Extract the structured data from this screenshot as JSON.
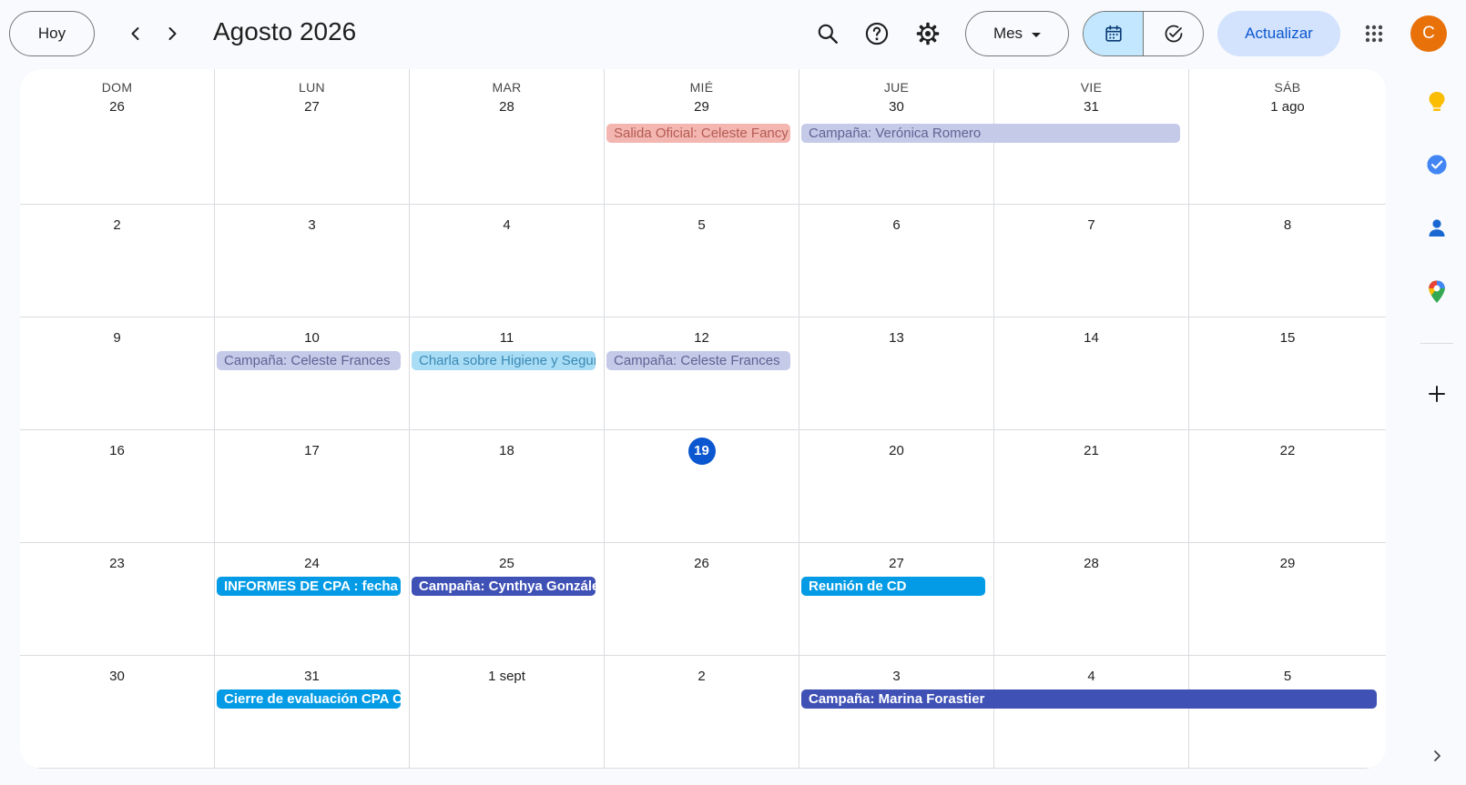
{
  "header": {
    "today_label": "Hoy",
    "title": "Agosto 2026",
    "view_label": "Mes",
    "update_label": "Actualizar",
    "avatar_letter": "C"
  },
  "colors": {
    "accent": "#0b57d0",
    "today_circle": "#0b57d0",
    "update_bg": "#d3e3fd",
    "avatar": "#e8710a",
    "toggle_active": "#c2e7ff"
  },
  "calendar": {
    "weekdays": [
      "DOM",
      "LUN",
      "MAR",
      "MIÉ",
      "JUE",
      "VIE",
      "SÁB"
    ],
    "weeks": [
      [
        "26",
        "27",
        "28",
        "29",
        "30",
        "31",
        "1 ago"
      ],
      [
        "2",
        "3",
        "4",
        "5",
        "6",
        "7",
        "8"
      ],
      [
        "9",
        "10",
        "11",
        "12",
        "13",
        "14",
        "15"
      ],
      [
        "16",
        "17",
        "18",
        "19",
        "20",
        "21",
        "22"
      ],
      [
        "23",
        "24",
        "25",
        "26",
        "27",
        "28",
        "29"
      ],
      [
        "30",
        "31",
        "1 sept",
        "2",
        "3",
        "4",
        "5"
      ]
    ],
    "today": {
      "week": 3,
      "day": 3
    },
    "events": [
      {
        "title": "Salida Oficial: Celeste Fancy",
        "week": 0,
        "start": 3,
        "span": 1,
        "bg": "#f4b6b1",
        "fg": "#b35b54",
        "style": "faded"
      },
      {
        "title": "Campaña: Verónica Romero",
        "week": 0,
        "start": 4,
        "span": 2,
        "bg": "#c5cae9",
        "fg": "#5f6493",
        "style": "faded"
      },
      {
        "title": "Campaña: Celeste Frances",
        "week": 2,
        "start": 1,
        "span": 1,
        "bg": "#c5cae9",
        "fg": "#5f6493",
        "style": "faded"
      },
      {
        "title": "Charla sobre Higiene y Seguridad",
        "week": 2,
        "start": 2,
        "span": 1,
        "bg": "#a9dcf5",
        "fg": "#3a8ab5",
        "style": "faded"
      },
      {
        "title": "Campaña: Celeste Frances",
        "week": 2,
        "start": 3,
        "span": 1,
        "bg": "#c5cae9",
        "fg": "#5f6493",
        "style": "faded"
      },
      {
        "title": "INFORMES DE CPA : fecha",
        "week": 4,
        "start": 1,
        "span": 1,
        "bg": "#039be5",
        "fg": "#ffffff",
        "style": "solid"
      },
      {
        "title": "Campaña: Cynthya González",
        "week": 4,
        "start": 2,
        "span": 1,
        "bg": "#3f51b5",
        "fg": "#ffffff",
        "style": "solid"
      },
      {
        "title": "Reunión de CD",
        "week": 4,
        "start": 4,
        "span": 1,
        "bg": "#039be5",
        "fg": "#ffffff",
        "style": "solid"
      },
      {
        "title": "Cierre de evaluación CPA C",
        "week": 5,
        "start": 1,
        "span": 1,
        "bg": "#039be5",
        "fg": "#ffffff",
        "style": "solid"
      },
      {
        "title": "Campaña: Marina Forastier",
        "week": 5,
        "start": 4,
        "span": 3,
        "bg": "#3f51b5",
        "fg": "#ffffff",
        "style": "solid"
      }
    ]
  },
  "side_panel": {
    "icons": [
      "keep-icon",
      "tasks-icon",
      "contacts-icon",
      "maps-icon",
      "add-icon",
      "chevron-right-icon"
    ]
  }
}
